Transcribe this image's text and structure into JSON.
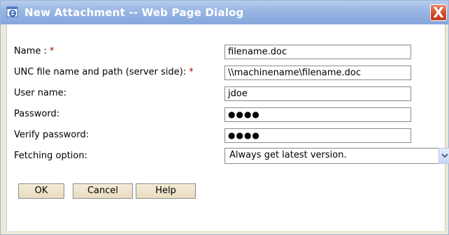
{
  "window": {
    "title": "New Attachment -- Web Page Dialog",
    "close_glyph": "X"
  },
  "form": {
    "name": {
      "label": "Name :",
      "required": "*",
      "value": "filename.doc"
    },
    "unc": {
      "label": "UNC file name and path (server side):",
      "required": "*",
      "value": "\\\\machinename\\filename.doc"
    },
    "username": {
      "label": "User name:",
      "value": "jdoe"
    },
    "password": {
      "label": "Password:",
      "value": "●●●●"
    },
    "verify": {
      "label": "Verify password:",
      "value": "●●●●"
    },
    "fetching": {
      "label": "Fetching option:",
      "selected": "Always get latest version."
    }
  },
  "buttons": {
    "ok": "OK",
    "cancel": "Cancel",
    "help": "Help"
  },
  "colors": {
    "title_bar": "#97b5e3",
    "close_button": "#d3502b",
    "required_marker": "#c00000",
    "button_face": "#ece1c8"
  },
  "icons": {
    "title": "ie-dialog-icon",
    "close": "close-icon",
    "dropdown": "chevron-down-icon"
  }
}
